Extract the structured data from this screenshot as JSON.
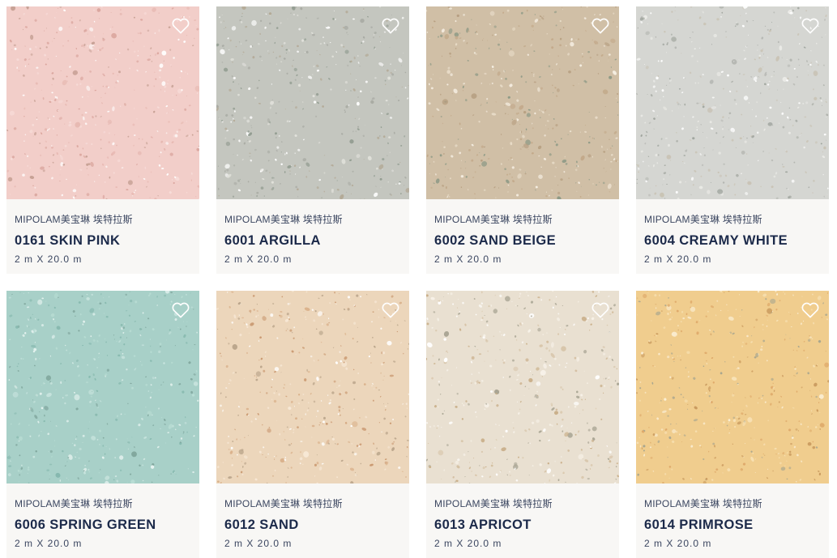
{
  "products": [
    {
      "brand": "MIPOLAM美宝琳 埃特拉斯",
      "name": "0161 SKIN PINK",
      "size": "2 m X 20.0 m",
      "color": "#f2cec9",
      "chips": [
        "#e6b8b1",
        "#f7dcd8",
        "#d9a49c",
        "#ffffff",
        "#c7a195"
      ]
    },
    {
      "brand": "MIPOLAM美宝琳 埃特拉斯",
      "name": "6001 ARGILLA",
      "size": "2 m X 20.0 m",
      "color": "#c4c6bf",
      "chips": [
        "#e2e2dc",
        "#a9aba4",
        "#ffffff",
        "#b3a996",
        "#8f9a8e"
      ]
    },
    {
      "brand": "MIPOLAM美宝琳 埃特拉斯",
      "name": "6002 SAND BEIGE",
      "size": "2 m X 20.0 m",
      "color": "#d0bfa6",
      "chips": [
        "#e8dcc8",
        "#b59d7f",
        "#f5eee2",
        "#8e9a86",
        "#c2a98a"
      ]
    },
    {
      "brand": "MIPOLAM美宝琳 埃特拉斯",
      "name": "6004 CREAMY WHITE",
      "size": "2 m X 20.0 m",
      "color": "#d5d6d2",
      "chips": [
        "#ffffff",
        "#b5b7b2",
        "#eaeae6",
        "#9fa49d",
        "#c9c3b5"
      ]
    },
    {
      "brand": "MIPOLAM美宝琳 埃特拉斯",
      "name": "6006 SPRING GREEN",
      "size": "2 m X 20.0 m",
      "color": "#a8d0c8",
      "chips": [
        "#c8e4de",
        "#86b8ae",
        "#e6f3f0",
        "#7fa59c",
        "#b9ddd4"
      ]
    },
    {
      "brand": "MIPOLAM美宝琳 埃特拉斯",
      "name": "6012 SAND",
      "size": "2 m X 20.0 m",
      "color": "#ecd6bb",
      "chips": [
        "#d9b08a",
        "#f7e8d6",
        "#c99870",
        "#ffffff",
        "#b9a48a"
      ]
    },
    {
      "brand": "MIPOLAM美宝琳 埃特拉斯",
      "name": "6013 APRICOT",
      "size": "2 m X 20.0 m",
      "color": "#e9e0d1",
      "chips": [
        "#f8f3ea",
        "#d8c6ab",
        "#c8ad87",
        "#ffffff",
        "#a9a594"
      ]
    },
    {
      "brand": "MIPOLAM美宝琳 埃特拉斯",
      "name": "6014 PRIMROSE",
      "size": "2 m X 20.0 m",
      "color": "#f0cd8e",
      "chips": [
        "#f8e2b6",
        "#dea96a",
        "#fbefd6",
        "#c99a5e",
        "#a9a68e"
      ]
    }
  ],
  "favorite_icon": "heart-outline-icon"
}
